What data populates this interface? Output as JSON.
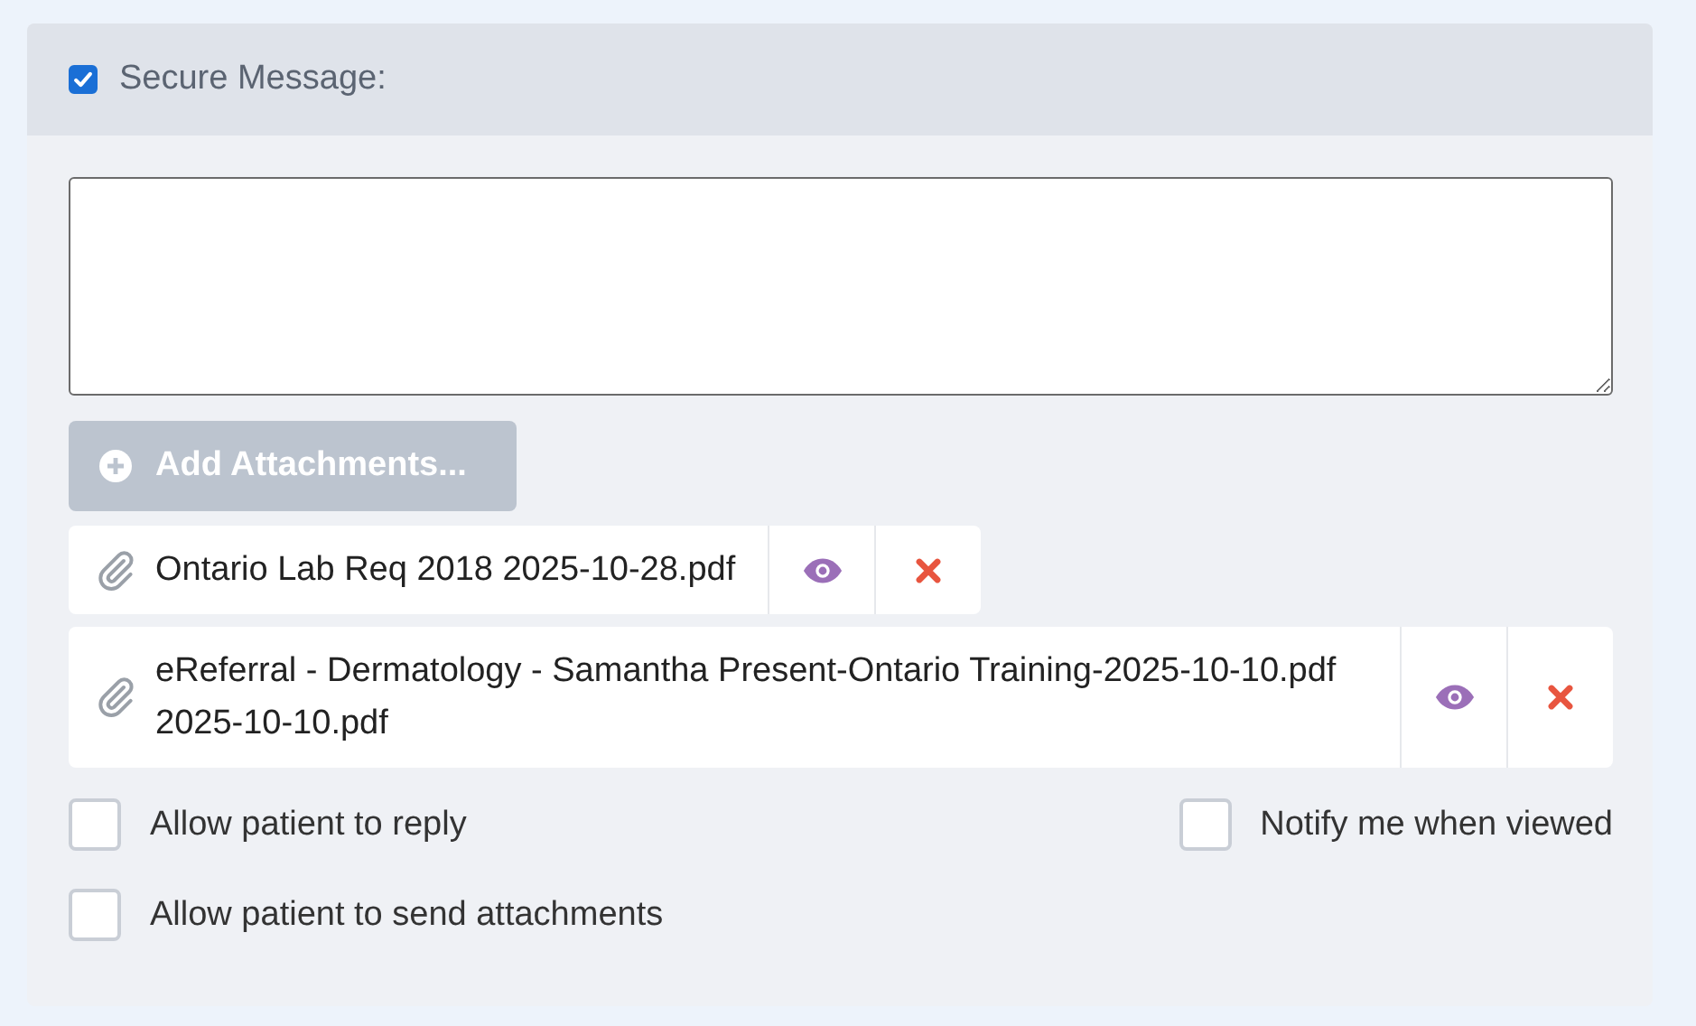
{
  "header": {
    "label": "Secure Message:",
    "checked": true
  },
  "add_button": {
    "label": "Add Attachments...",
    "disabled": true
  },
  "attachments": [
    {
      "name": "Ontario Lab Req 2018 2025-10-28.pdf"
    },
    {
      "name": "eReferral - Dermatology - Samantha Present-Ontario Training-2025-10-10.pdf 2025-10-10.pdf"
    }
  ],
  "options": [
    {
      "label": "Allow patient to reply",
      "checked": false
    },
    {
      "label": "Notify me when viewed",
      "checked": false
    },
    {
      "label": "Allow patient to send attachments",
      "checked": false
    }
  ]
}
